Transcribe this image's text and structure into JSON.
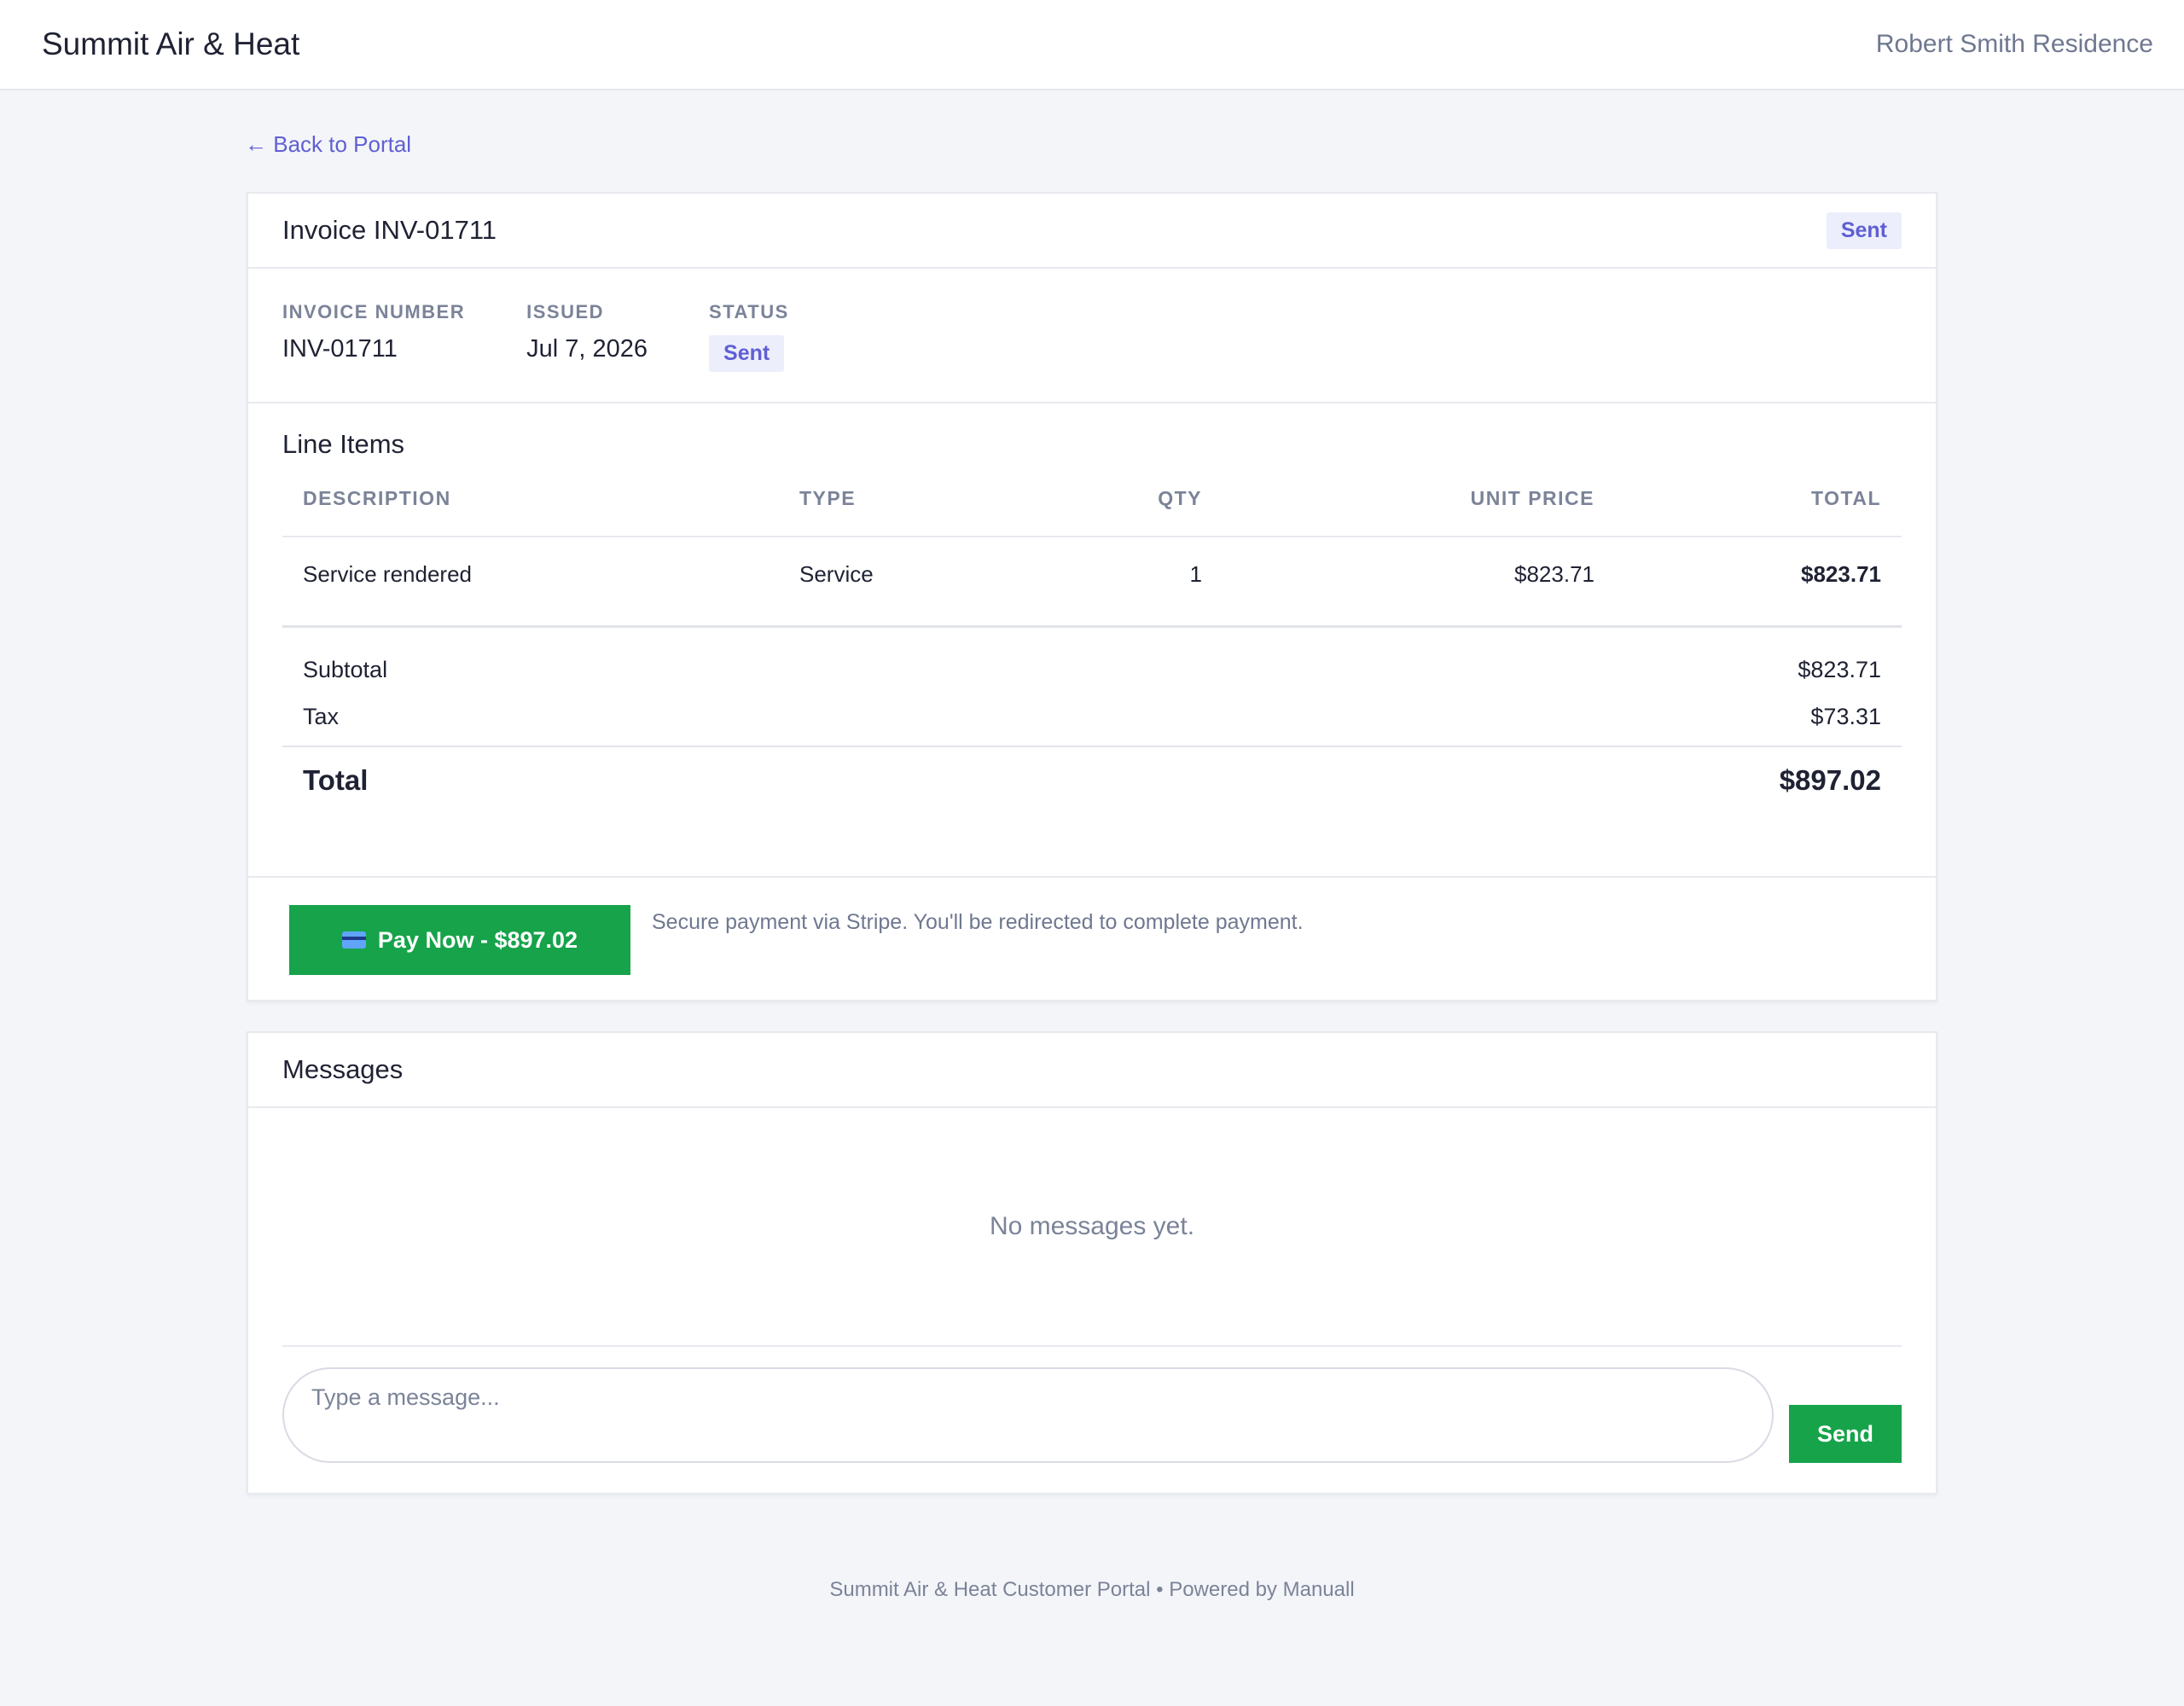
{
  "header": {
    "brand": "Summit Air & Heat",
    "residence": "Robert Smith Residence"
  },
  "nav": {
    "back_label": "← Back to Portal"
  },
  "invoice": {
    "title": "Invoice INV-01711",
    "status_badge": "Sent",
    "meta": {
      "number_label": "INVOICE NUMBER",
      "number_value": "INV-01711",
      "issued_label": "ISSUED",
      "issued_value": "Jul 7, 2026",
      "status_label": "STATUS",
      "status_value": "Sent"
    },
    "line_items_title": "Line Items",
    "columns": {
      "description": "DESCRIPTION",
      "type": "TYPE",
      "qty": "QTY",
      "unit_price": "UNIT PRICE",
      "total": "TOTAL"
    },
    "items": [
      {
        "description": "Service rendered",
        "type": "Service",
        "qty": "1",
        "unit_price": "$823.71",
        "total": "$823.71"
      }
    ],
    "totals": {
      "subtotal_label": "Subtotal",
      "subtotal_value": "$823.71",
      "tax_label": "Tax",
      "tax_value": "$73.31",
      "total_label": "Total",
      "total_value": "$897.02"
    },
    "payment": {
      "button_label": "Pay Now - $897.02",
      "note": "Secure payment via Stripe. You'll be redirected to complete payment."
    }
  },
  "messages": {
    "title": "Messages",
    "empty_text": "No messages yet.",
    "input_placeholder": "Type a message...",
    "send_label": "Send"
  },
  "footer": {
    "text": "Summit Air & Heat Customer Portal • Powered by Manuall"
  },
  "colors": {
    "accent": "#5f5fd4",
    "pay_green": "#16a34a",
    "badge_bg": "#eceefc"
  }
}
